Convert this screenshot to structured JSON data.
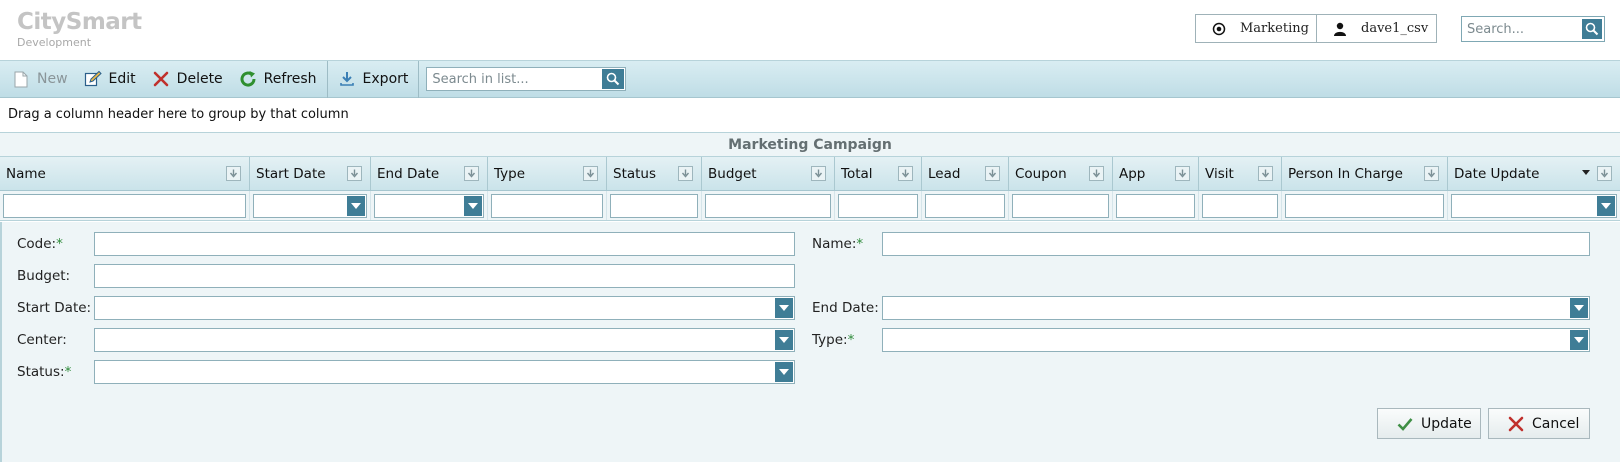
{
  "app": {
    "title": "CitySmart",
    "subtitle": "Development"
  },
  "user_bar": {
    "department": "Marketing",
    "username": "dave1_csv"
  },
  "top_search": {
    "placeholder": "Search..."
  },
  "toolbar": {
    "new_label": "New",
    "edit_label": "Edit",
    "delete_label": "Delete",
    "refresh_label": "Refresh",
    "export_label": "Export",
    "search_placeholder": "Search in list..."
  },
  "group_panel": {
    "text": "Drag a column header here to group by that column"
  },
  "grid": {
    "caption": "Marketing Campaign",
    "columns": [
      "Name",
      "Start Date",
      "End Date",
      "Type",
      "Status",
      "Budget",
      "Total",
      "Lead",
      "Coupon",
      "App",
      "Visit",
      "Person In Charge",
      "Date Update"
    ]
  },
  "form": {
    "code_label": "Code:",
    "name_label": "Name:",
    "budget_label": "Budget:",
    "start_date_label": "Start Date:",
    "end_date_label": "End Date:",
    "center_label": "Center:",
    "type_label": "Type:",
    "status_label": "Status:",
    "required_mark": "*",
    "update_label": "Update",
    "cancel_label": "Cancel"
  },
  "colors": {
    "accent": "#3f7d96",
    "required": "#2e8b3a",
    "delete": "#c0302c",
    "refresh": "#2f8f2f"
  }
}
